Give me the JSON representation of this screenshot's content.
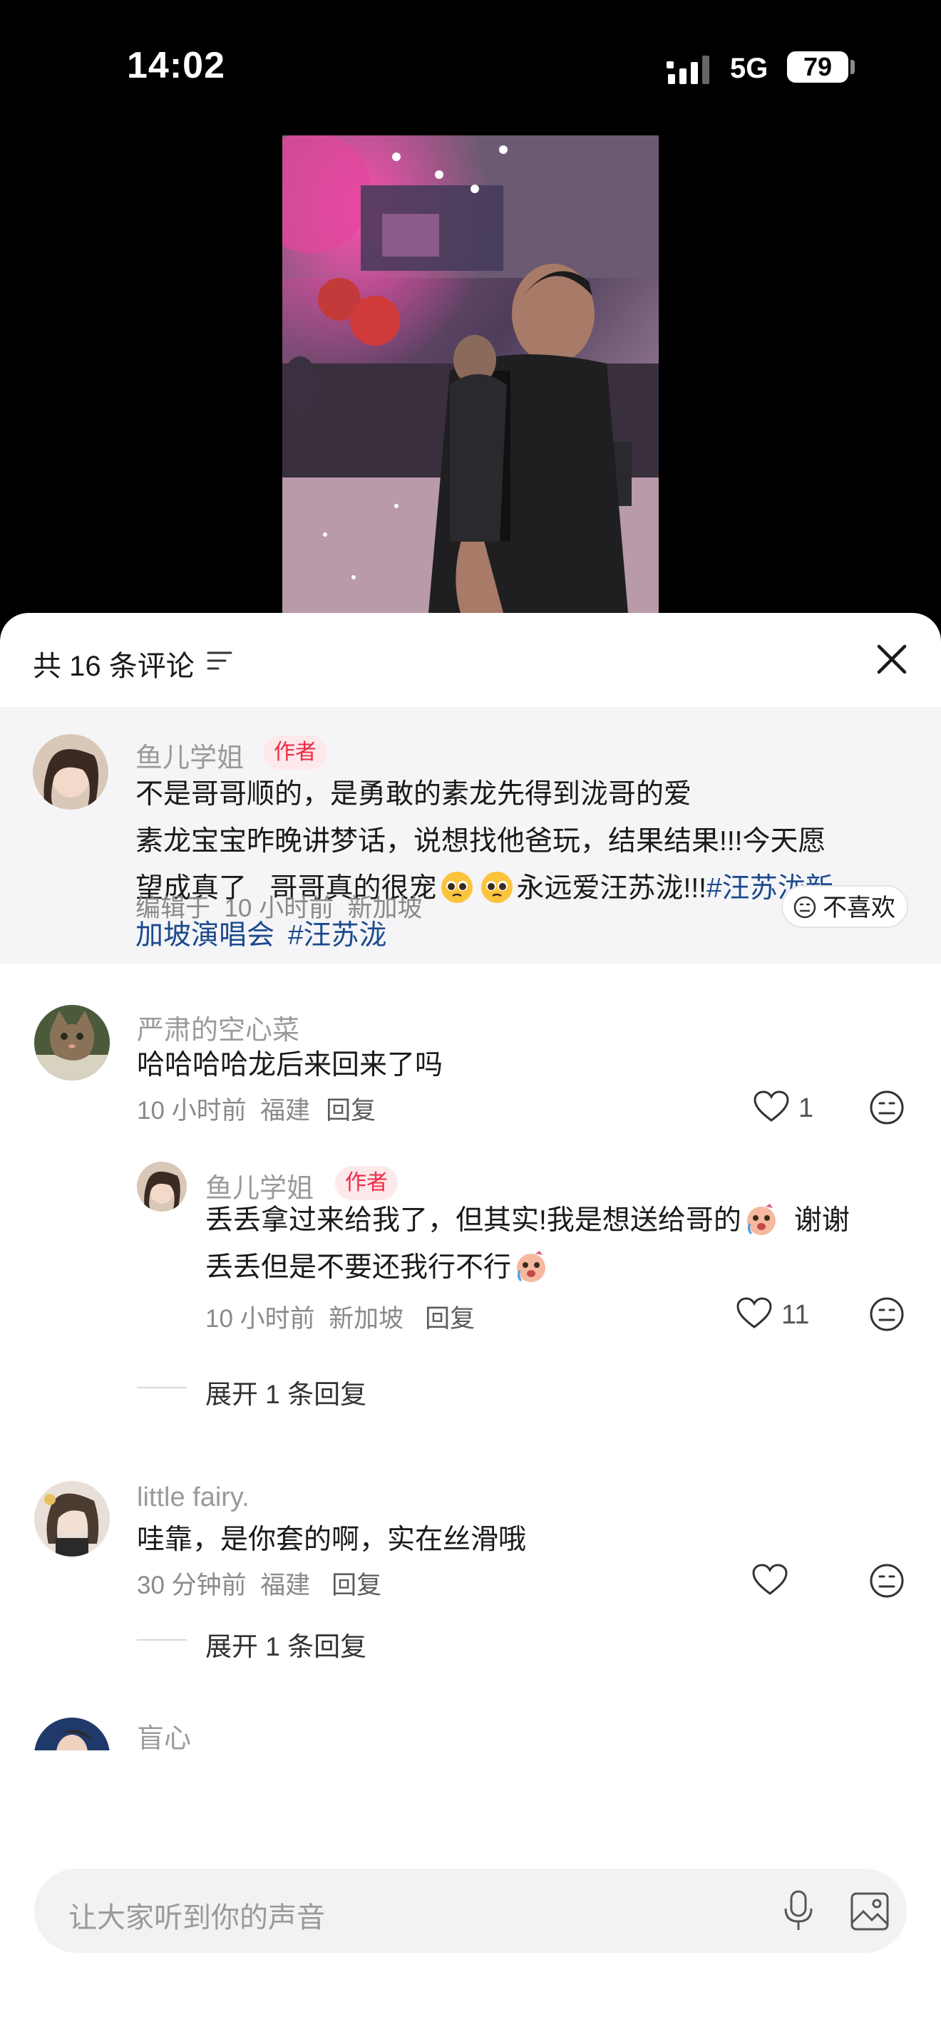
{
  "status_bar": {
    "time": "14:02",
    "network": "5G",
    "battery": "79"
  },
  "sheet": {
    "title": "共 16 条评论",
    "icons": {
      "sort": "sort-filter-icon",
      "close": "close-icon"
    }
  },
  "comments": [
    {
      "user": "鱼儿学姐",
      "badge": "作者",
      "text_line1": "不是哥哥顺的，是勇敢的素龙先得到泷哥的爱",
      "text_line2": "素龙宝宝昨晚讲梦话，说想找他爸玩，结果结果!!!今天愿",
      "text_line3a": "望成真了   哥哥真的很宠",
      "text_line3b": "永远爱汪苏泷!!!",
      "hashtag1": "#汪苏泷新",
      "hashtag1b": "加坡演唱会",
      "hashtag2": "#汪苏泷",
      "meta": "编辑于  10 小时前  新加坡",
      "dislike": "不喜欢"
    },
    {
      "user": "严肃的空心菜",
      "text": "哈哈哈哈龙后来回来了吗",
      "meta": "10 小时前  福建",
      "reply": "回复",
      "likes": "1",
      "sub_reply": {
        "user": "鱼儿学姐",
        "badge": "作者",
        "text_line1a": "丢丢拿过来给我了，但其实!我是想送给哥的",
        "text_line1b": "谢谢",
        "text_line2": "丢丢但是不要还我行不行",
        "meta": "10 小时前  新加坡",
        "reply": "回复",
        "likes": "11"
      },
      "expand": "展开 1 条回复"
    },
    {
      "user": "little fairy.",
      "text": "哇靠，是你套的啊，实在丝滑哦",
      "meta": "30 分钟前  福建",
      "reply": "回复",
      "expand": "展开 1 条回复"
    },
    {
      "user": "盲心"
    }
  ],
  "input": {
    "placeholder": "让大家听到你的声音",
    "icons": {
      "mic": "microphone-icon",
      "image": "image-icon"
    }
  }
}
